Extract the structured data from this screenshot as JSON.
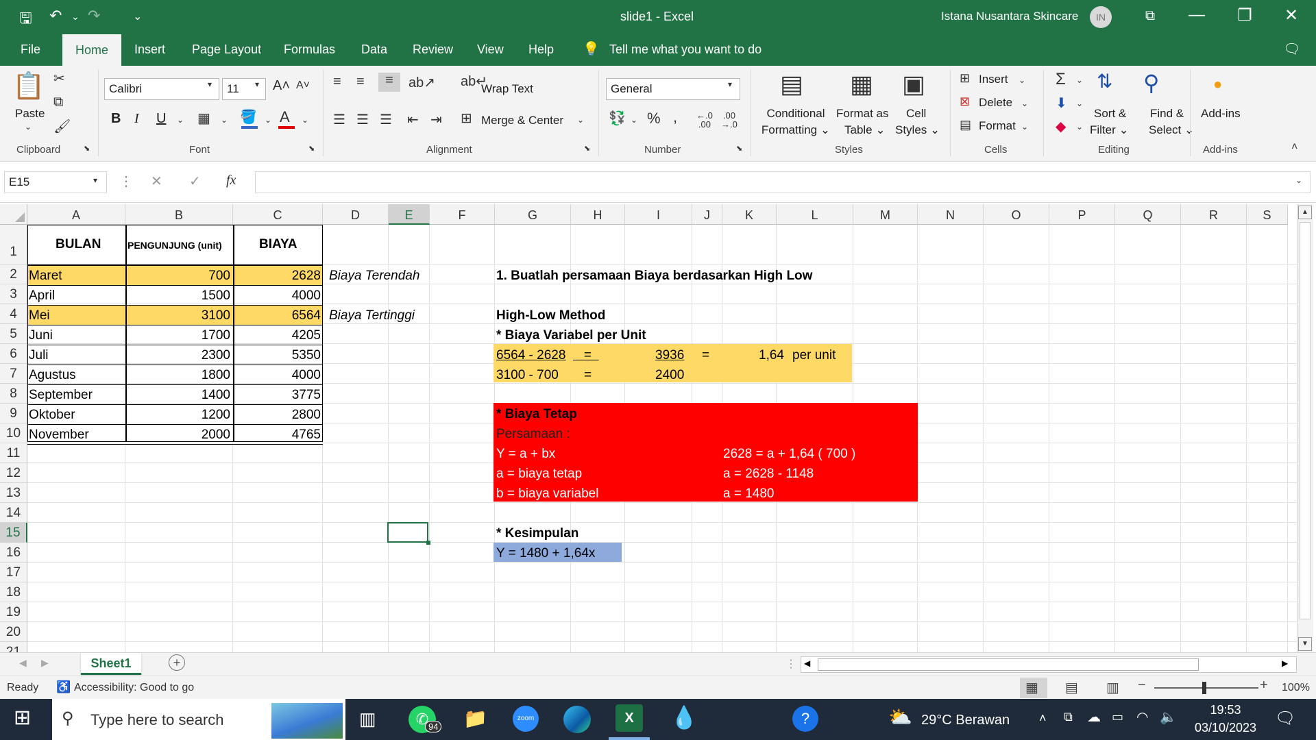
{
  "window": {
    "title": "slide1  -  Excel",
    "account": "Istana Nusantara Skincare",
    "avatar": "IN",
    "restore_icon": "restore-window-icon",
    "minimize": "—",
    "maximize": "❐",
    "close": "✕"
  },
  "tabs": [
    "File",
    "Home",
    "Insert",
    "Page Layout",
    "Formulas",
    "Data",
    "Review",
    "View",
    "Help"
  ],
  "tell_me": "Tell me what you want to do",
  "ribbon": {
    "paste": "Paste",
    "clipboard": "Clipboard",
    "font_name": "Calibri",
    "font_size": "11",
    "font_group": "Font",
    "bold": "B",
    "italic": "I",
    "underline": "U",
    "wrap_text": "Wrap Text",
    "merge_center": "Merge & Center",
    "alignment_group": "Alignment",
    "number_format": "General",
    "number_group": "Number",
    "conditional_formatting": [
      "Conditional",
      "Formatting ⌄"
    ],
    "format_as_table": [
      "Format as",
      "Table ⌄"
    ],
    "cell_styles": [
      "Cell",
      "Styles ⌄"
    ],
    "styles_group": "Styles",
    "insert": "Insert",
    "delete": "Delete",
    "format": "Format",
    "cells_group": "Cells",
    "sort_filter": [
      "Sort &",
      "Filter ⌄"
    ],
    "find_select": [
      "Find &",
      "Select ⌄"
    ],
    "editing_group": "Editing",
    "addins": "Add-ins",
    "addins_group": "Add-ins"
  },
  "formula_bar": {
    "name_box": "E15",
    "fx": "fx",
    "formula": ""
  },
  "columns": [
    "A",
    "B",
    "C",
    "D",
    "E",
    "F",
    "G",
    "H",
    "I",
    "J",
    "K",
    "L",
    "M",
    "N",
    "O",
    "P",
    "Q",
    "R",
    "S"
  ],
  "rows": [
    "1",
    "2",
    "3",
    "4",
    "5",
    "6",
    "7",
    "8",
    "9",
    "10",
    "11",
    "12",
    "13",
    "14",
    "15",
    "16",
    "17",
    "18",
    "19",
    "20",
    "21"
  ],
  "table": {
    "headers": [
      "BULAN",
      "PENGUNJUNG (unit)",
      "BIAYA"
    ],
    "rows": [
      [
        "Maret",
        "700",
        "2628"
      ],
      [
        "April",
        "1500",
        "4000"
      ],
      [
        "Mei",
        "3100",
        "6564"
      ],
      [
        "Juni",
        "1700",
        "4205"
      ],
      [
        "Juli",
        "2300",
        "5350"
      ],
      [
        "Agustus",
        "1800",
        "4000"
      ],
      [
        "September",
        "1400",
        "3775"
      ],
      [
        "Oktober",
        "1200",
        "2800"
      ],
      [
        "November",
        "2000",
        "4765"
      ]
    ]
  },
  "notes": {
    "low": "Biaya Terendah",
    "high": "Biaya Tertinggi"
  },
  "work": {
    "q1": "1. Buatlah persamaan Biaya berdasarkan High Low",
    "method": "High-Low Method",
    "var_title": "* Biaya Variabel per Unit",
    "num_expr": "6564 - 2628",
    "den_expr": "3100 - 700",
    "eq": "=",
    "num_val": "3936",
    "den_val": "2400",
    "result": "1,64",
    "per_unit": "per unit",
    "fixed_title": "* Biaya Tetap",
    "persamaan": "Persamaan :",
    "y_eq": "Y = a + bx",
    "a_def": "a = biaya tetap",
    "b_def": "b = biaya variabel",
    "calc1": "2628 = a + 1,64 ( 700 )",
    "calc2": "a = 2628 - 1148",
    "calc3": "a = 1480",
    "conclusion_title": "* Kesimpulan",
    "conclusion": "Y = 1480 + 1,64x"
  },
  "sheet": {
    "tab": "Sheet1"
  },
  "status": {
    "ready": "Ready",
    "accessibility": "Accessibility: Good to go",
    "zoom": "100%"
  },
  "taskbar": {
    "search": "Type here to search",
    "whatsapp_badge": "94",
    "weather": "29°C  Berawan",
    "time": "19:53",
    "date": "03/10/2023"
  }
}
